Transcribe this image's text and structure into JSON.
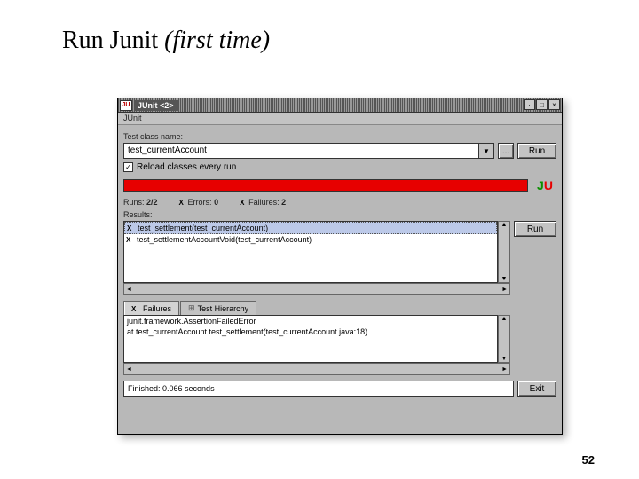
{
  "slide": {
    "title_plain": "Run Junit ",
    "title_italic": "(first time)",
    "page_number": "52"
  },
  "window": {
    "title": "JUnit <2>",
    "app_icon": "JU",
    "menu": {
      "junit": "JUnit"
    },
    "labels": {
      "test_class_name": "Test class name:",
      "reload": "Reload classes every run",
      "runs": "Runs:",
      "errors": "Errors:",
      "failures": "Failures:",
      "results": "Results:"
    },
    "class_input": "test_currentAccount",
    "checkbox_checked": "✓",
    "buttons": {
      "browse": "...",
      "run_top": "Run",
      "run_side": "Run",
      "exit": "Exit"
    },
    "stats": {
      "runs": "2/2",
      "errors": "0",
      "failures": "2"
    },
    "result_items": [
      "test_settlement(test_currentAccount)",
      "test_settlementAccountVoid(test_currentAccount)"
    ],
    "tabs": {
      "failures": "Failures",
      "hierarchy": "Test Hierarchy"
    },
    "trace_lines": [
      "junit.framework.AssertionFailedError",
      "  at test_currentAccount.test_settlement(test_currentAccount.java:18)"
    ],
    "status": "Finished: 0.066 seconds",
    "logo": {
      "j": "J",
      "u": "U"
    }
  }
}
